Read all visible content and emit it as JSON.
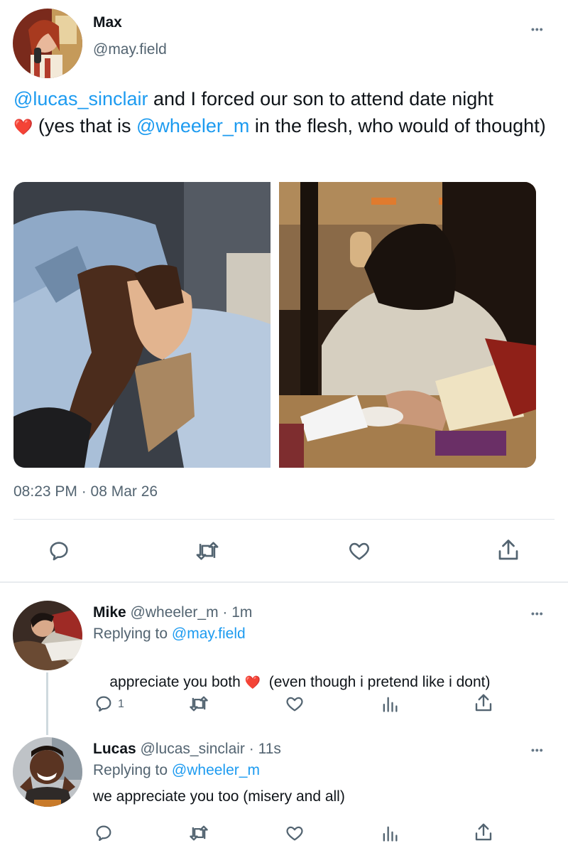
{
  "main_tweet": {
    "author_name": "Max",
    "author_handle": "@may.field",
    "text": {
      "mention1": "@lucas_sinclair",
      "part1": " and I forced our son to attend date night",
      "emoji": "❤️",
      "part2": " (yes that is ",
      "mention2": "@wheeler_m",
      "part3": " in the flesh, who would of thought)"
    },
    "timestamp": "08:23 PM · 08 Mar 26",
    "more_label": "•••"
  },
  "replies": [
    {
      "name": "Mike",
      "handle": "@wheeler_m",
      "sep": "·",
      "time": "1m",
      "replying_prefix": "Replying to ",
      "replying_to": "@may.field",
      "text_part1": "appreciate you both ",
      "emoji": "❤️",
      "text_part2": "  (even though i pretend like i dont)",
      "reply_count": "1",
      "more_label": "•••"
    },
    {
      "name": "Lucas",
      "handle": "@lucas_sinclair",
      "sep": "·",
      "time": "11s",
      "replying_prefix": "Replying to ",
      "replying_to": "@wheeler_m",
      "text": "we appreciate you too (misery and all)",
      "more_label": "•••"
    }
  ],
  "colors": {
    "accent": "#1d9bf0",
    "icon_gray": "#536471",
    "heart_red": "#e0245e"
  }
}
